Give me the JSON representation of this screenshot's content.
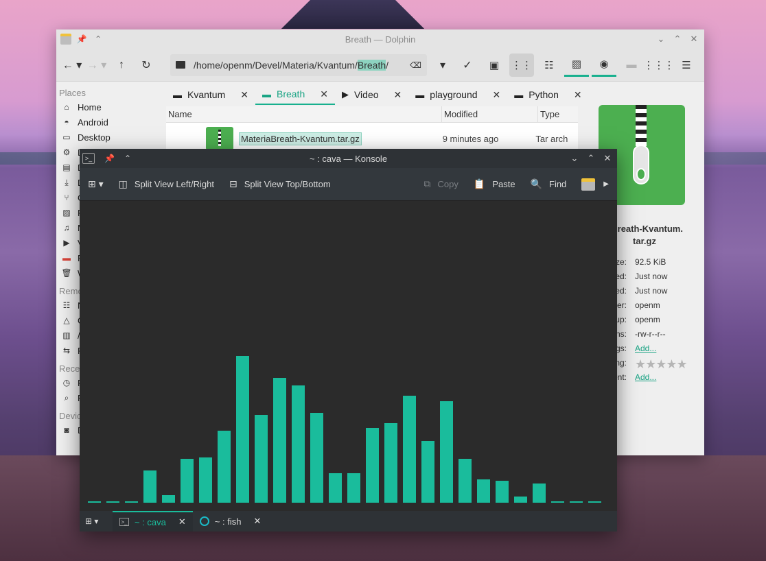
{
  "dolphin": {
    "title": "Breath — Dolphin",
    "url_prefix": "/home/openm/Devel/Materia/Kvantum/",
    "url_highlight": "Breath",
    "url_suffix": "/",
    "places": {
      "header": "Places",
      "items": [
        {
          "label": "Home",
          "icon": "home-icon"
        },
        {
          "label": "Android",
          "icon": "android-icon"
        },
        {
          "label": "Desktop",
          "icon": "desktop-icon"
        },
        {
          "label": "D",
          "icon": "gear-icon"
        },
        {
          "label": "D",
          "icon": "document-icon"
        },
        {
          "label": "D",
          "icon": "download-icon"
        },
        {
          "label": "G",
          "icon": "git-icon"
        },
        {
          "label": "P",
          "icon": "picture-icon"
        },
        {
          "label": "M",
          "icon": "music-icon"
        },
        {
          "label": "V",
          "icon": "video-icon"
        },
        {
          "label": "R",
          "icon": "red-folder-icon"
        },
        {
          "label": "W",
          "icon": "trash-icon"
        }
      ],
      "remote_header": "Remo",
      "remote_items": [
        {
          "label": "N",
          "icon": "network-icon"
        },
        {
          "label": "G",
          "icon": "drive-icon"
        },
        {
          "label": "/",
          "icon": "server-icon"
        },
        {
          "label": "R",
          "icon": "remote-icon"
        }
      ],
      "recent_header": "Rece",
      "recent_items": [
        {
          "label": "R",
          "icon": "clock-icon"
        },
        {
          "label": "R",
          "icon": "recent-location-icon"
        }
      ],
      "devices_header": "Devic",
      "devices_items": [
        {
          "label": "D",
          "icon": "disk-icon"
        }
      ]
    },
    "tabs": [
      {
        "label": "Kvantum",
        "icon": "folder-icon",
        "active": false
      },
      {
        "label": "Breath",
        "icon": "folder-icon",
        "active": true
      },
      {
        "label": "Video",
        "icon": "video-icon",
        "active": false
      },
      {
        "label": "playground",
        "icon": "folder-icon",
        "active": false
      },
      {
        "label": "Python",
        "icon": "folder-icon",
        "active": false
      }
    ],
    "columns": {
      "name": "Name",
      "modified": "Modified",
      "type": "Type"
    },
    "file": {
      "name": "MateriaBreath-Kvantum.tar.gz",
      "modified": "9 minutes ago",
      "type": "Tar arch"
    },
    "info": {
      "name_line1": "aBreath-Kvantum.",
      "name_line2": "tar.gz",
      "rows": [
        {
          "k": "Size:",
          "v": "92.5 KiB"
        },
        {
          "k": "fied:",
          "v": "Just now"
        },
        {
          "k": "ated:",
          "v": "Just now"
        },
        {
          "k": "wner:",
          "v": "openm"
        },
        {
          "k": "roup:",
          "v": "openm"
        },
        {
          "k": "ions:",
          "v": "-rw-r--r--"
        },
        {
          "k": "Tags:",
          "v": "Add...",
          "link": true
        },
        {
          "k": "ting:",
          "v": "★★★★★",
          "stars": true
        },
        {
          "k": "ment:",
          "v": "Add...",
          "link": true
        }
      ]
    }
  },
  "konsole": {
    "title": "~ : cava — Konsole",
    "toolbar": {
      "split_lr": "Split View Left/Right",
      "split_tb": "Split View Top/Bottom",
      "copy": "Copy",
      "paste": "Paste",
      "find": "Find"
    },
    "tabs": [
      {
        "label": "~ : cava",
        "active": true
      },
      {
        "label": "~ : fish",
        "active": false
      }
    ],
    "visualizer_color": "#1abc9c",
    "visualizer_levels": [
      0.01,
      0.01,
      0.01,
      0.22,
      0.05,
      0.3,
      0.31,
      0.49,
      1.0,
      0.6,
      0.85,
      0.8,
      0.61,
      0.2,
      0.2,
      0.51,
      0.54,
      0.73,
      0.42,
      0.69,
      0.3,
      0.16,
      0.15,
      0.04,
      0.13,
      0.01,
      0.01,
      0.01
    ]
  }
}
